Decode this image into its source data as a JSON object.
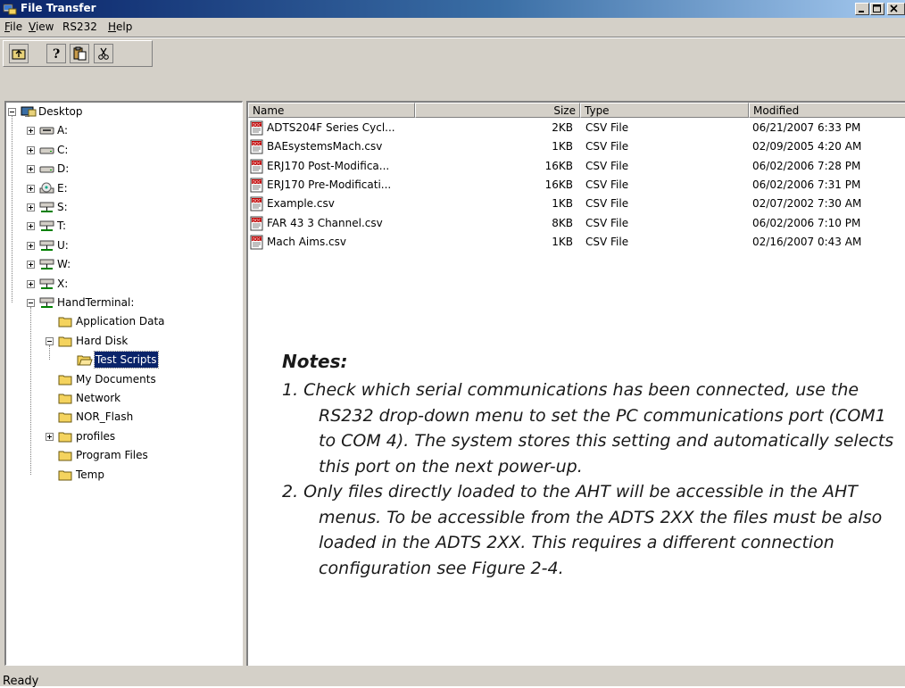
{
  "window": {
    "title": "File Transfer"
  },
  "menu": [
    {
      "label": "File",
      "underline": "F"
    },
    {
      "label": "View",
      "underline": "V"
    },
    {
      "label": "RS232",
      "underline": ""
    },
    {
      "label": "Help",
      "underline": "H"
    }
  ],
  "toolbar": {
    "buttons": [
      "up-folder-icon",
      "help-icon",
      "paste-icon",
      "cut-icon"
    ]
  },
  "tree": {
    "root": "Desktop",
    "drives": [
      "A:",
      "C:",
      "D:",
      "E:",
      "S:",
      "T:",
      "U:",
      "W:",
      "X:"
    ],
    "device": "HandTerminal:",
    "folders": [
      "Application Data",
      "Hard Disk",
      "Test Scripts",
      "My Documents",
      "Network",
      "NOR_Flash",
      "profiles",
      "Program Files",
      "Temp"
    ],
    "selected": "Test Scripts"
  },
  "columns": {
    "name": "Name",
    "size": "Size",
    "type": "Type",
    "modified": "Modified"
  },
  "files": [
    {
      "name": "ADTS204F Series Cycl...",
      "size": "2KB",
      "type": "CSV File",
      "modified": "06/21/2007 6:33 PM"
    },
    {
      "name": "BAEsystemsMach.csv",
      "size": "1KB",
      "type": "CSV File",
      "modified": "02/09/2005 4:20 AM"
    },
    {
      "name": "ERJ170 Post-Modifica...",
      "size": "16KB",
      "type": "CSV File",
      "modified": "06/02/2006 7:28 PM"
    },
    {
      "name": "ERJ170 Pre-Modificati...",
      "size": "16KB",
      "type": "CSV File",
      "modified": "06/02/2006 7:31 PM"
    },
    {
      "name": "Example.csv",
      "size": "1KB",
      "type": "CSV File",
      "modified": "02/07/2002 7:30 AM"
    },
    {
      "name": "FAR 43 3 Channel.csv",
      "size": "8KB",
      "type": "CSV File",
      "modified": "06/02/2006 7:10 PM"
    },
    {
      "name": "Mach Aims.csv",
      "size": "1KB",
      "type": "CSV File",
      "modified": "02/16/2007 0:43 AM"
    }
  ],
  "notes": {
    "title": "Notes:",
    "items": [
      "1.  Check which serial communications has been connected, use the RS232 drop-down menu to set the PC communications port (COM1 to COM 4).  The system stores this setting and automatically selects this port on the next power-up.",
      "2.  Only files directly loaded to the AHT will be accessible in the AHT menus.  To be accessible from the ADTS 2XX the files must be also loaded in the ADTS 2XX.  This requires a different connection configuration see Figure 2-4."
    ]
  },
  "status": {
    "text": "Ready"
  },
  "colors": {
    "title_start": "#0a246a",
    "title_end": "#a6caf0",
    "chrome": "#d4d0c8",
    "selection": "#0a246a"
  }
}
